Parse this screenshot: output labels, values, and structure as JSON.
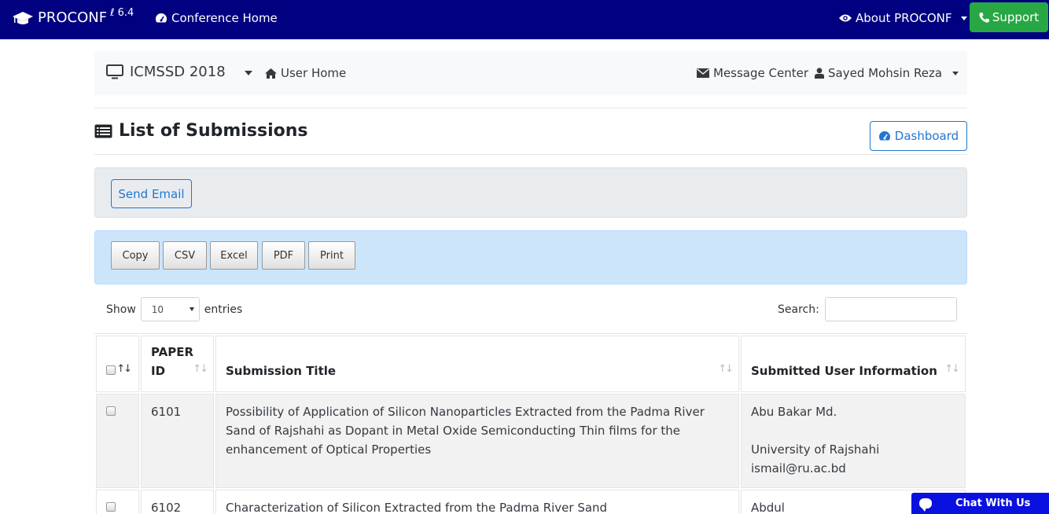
{
  "topnav": {
    "brand": "PROCONF",
    "version": "6.4",
    "conference_home": "Conference Home",
    "about": "About PROCONF",
    "support": "Support"
  },
  "subnav": {
    "conference": "ICMSSD 2018",
    "user_home": "User Home",
    "message_center": "Message Center",
    "user_name": "Sayed Mohsin Reza"
  },
  "page": {
    "title": "List of Submissions",
    "dashboard": "Dashboard",
    "send_email": "Send Email"
  },
  "export_buttons": [
    "Copy",
    "CSV",
    "Excel",
    "PDF",
    "Print"
  ],
  "table_controls": {
    "show_label": "Show",
    "page_length": "10",
    "entries_label": "entries",
    "search_label": "Search:",
    "search_value": ""
  },
  "table": {
    "headers": [
      "",
      "PAPER ID",
      "Submission Title",
      "Submitted User Information"
    ],
    "rows": [
      {
        "paper_id": "6101",
        "title": "Possibility of Application of Silicon Nanoparticles Extracted from the Padma River Sand of Rajshahi as Dopant in Metal Oxide Semiconducting Thin films for the enhancement of Optical Properties",
        "user_name": "Abu Bakar Md.",
        "user_org": "University of Rajshahi",
        "user_email": "ismail@ru.ac.bd"
      },
      {
        "paper_id": "6102",
        "title": "Characterization of Silicon Extracted from the Padma River Sand",
        "user_name": "Abdul",
        "user_org": "",
        "user_email": ""
      }
    ]
  },
  "chat": {
    "label": "Chat With Us"
  },
  "colors": {
    "navbar": "#000080",
    "support": "#28a745",
    "primary": "#2176d2",
    "chat": "#0a10e0"
  }
}
